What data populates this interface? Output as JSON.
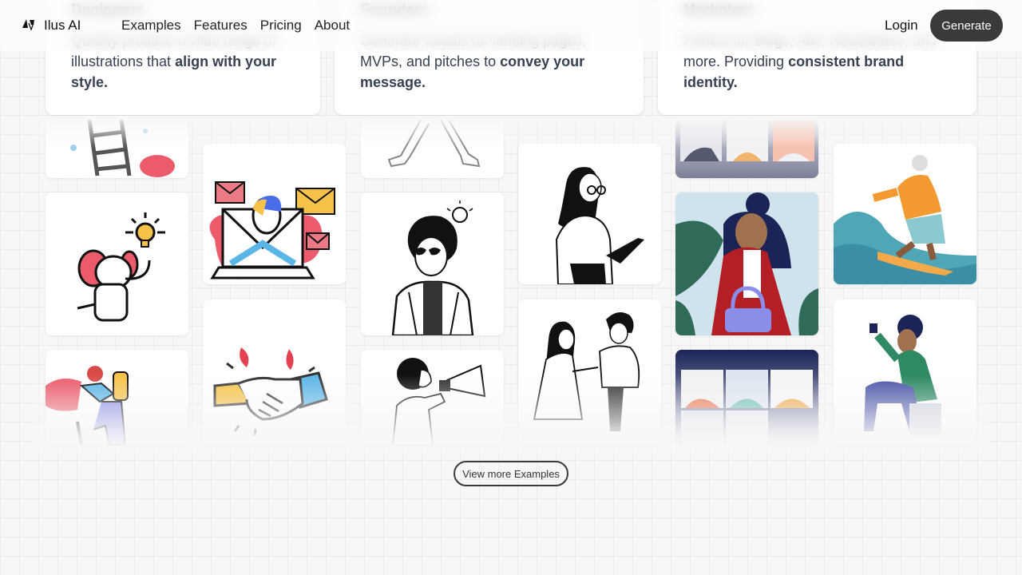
{
  "brand": {
    "name": "Ilus AI",
    "logo_icon": "ilus-logo-icon"
  },
  "nav": {
    "links": [
      "Examples",
      "Features",
      "Pricing",
      "About"
    ],
    "login_label": "Login",
    "generate_label": "Generate"
  },
  "feature_cards": [
    {
      "title": "Designers",
      "text_plain": "Quickly produce a wide range of illustrations that ",
      "text_bold": "align with your style."
    },
    {
      "title": "Founders",
      "text_plain": "Generate visuals for landing pages, MVPs, and pitches to ",
      "text_bold": "convey your message."
    },
    {
      "title": "Marketers",
      "text_plain": "Perfect for Blogs, Ads, Newsletters, and more. Providing ",
      "text_bold": "consistent brand identity."
    }
  ],
  "gallery": [
    {
      "subject": "ladder climber illustration"
    },
    {
      "subject": "elephant with lightbulb"
    },
    {
      "subject": "mountain climber with backpack"
    },
    {
      "subject": "person in laptop with envelopes"
    },
    {
      "subject": "handshake illustration"
    },
    {
      "subject": "walking legs sketch"
    },
    {
      "subject": "person with sunglasses and lightbulb sketch"
    },
    {
      "subject": "person with megaphone sketch"
    },
    {
      "subject": "woman with glasses holding laptop sketch"
    },
    {
      "subject": "two people shaking hands sketch"
    },
    {
      "subject": "video call grid top"
    },
    {
      "subject": "woman in red coat with purple handbag"
    },
    {
      "subject": "video call grid"
    },
    {
      "subject": "elderly man surfing"
    },
    {
      "subject": "person sitting with lightbulb"
    }
  ],
  "view_more_label": "View more Examples",
  "colors": {
    "accent_dark": "#3a3a3a",
    "background": "#f7f7f7"
  }
}
